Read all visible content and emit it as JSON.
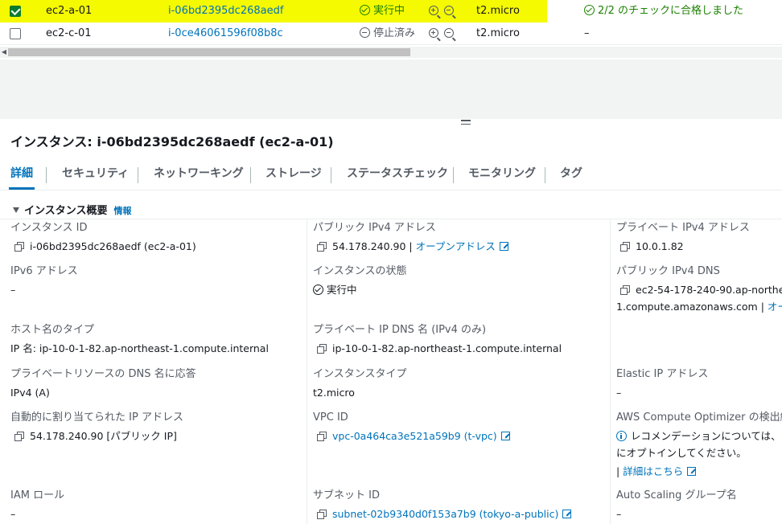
{
  "instances": {
    "rows": [
      {
        "selected": true,
        "name": "ec2-a-01",
        "instance_id": "i-06bd2395dc268aedf",
        "state": "実行中",
        "type": "t2.micro",
        "status_check": "2/2 のチェックに合格しました"
      },
      {
        "selected": false,
        "name": "ec2-c-01",
        "instance_id": "i-0ce46061596f08b8c",
        "state": "停止済み",
        "type": "t2.micro",
        "status_check": "–"
      }
    ],
    "highlight_color": "#f5fa00"
  },
  "detail": {
    "title": "インスタンス: i-06bd2395dc268aedf (ec2-a-01)",
    "tabs": [
      "詳細",
      "セキュリティ",
      "ネットワーキング",
      "ストレージ",
      "ステータスチェック",
      "モニタリング",
      "タグ"
    ],
    "active_tab": "詳細",
    "section_title": "インスタンス概要",
    "section_info": "情報",
    "col1": {
      "instance_id_label": "インスタンス ID",
      "instance_id_value": "i-06bd2395dc268aedf (ec2-a-01)",
      "ipv6_label": "IPv6 アドレス",
      "ipv6_value": "–",
      "hostname_type_label": "ホスト名のタイプ",
      "hostname_type_value": "IP 名: ip-10-0-1-82.ap-northeast-1.compute.internal",
      "private_dns_answer_label": "プライベートリソースの DNS 名に応答",
      "private_dns_answer_value": "IPv4 (A)",
      "auto_ip_label": "自動的に割り当てられた IP アドレス",
      "auto_ip_value": "54.178.240.90 [パブリック IP]",
      "iam_role_label": "IAM ロール",
      "iam_role_value": "–"
    },
    "col2": {
      "public_ipv4_label": "パブリック IPv4 アドレス",
      "public_ipv4_value": "54.178.240.90 |",
      "open_address": "オープンアドレス",
      "state_label": "インスタンスの状態",
      "state_value": "実行中",
      "private_ip_dns_label": "プライベート IP DNS 名 (IPv4 のみ)",
      "private_ip_dns_value": "ip-10-0-1-82.ap-northeast-1.compute.internal",
      "instance_type_label": "インスタンスタイプ",
      "instance_type_value": "t2.micro",
      "vpc_label": "VPC ID",
      "vpc_value": "vpc-0a464ca3e521a59b9 (t-vpc)",
      "subnet_label": "サブネット ID",
      "subnet_value": "subnet-02b9340d0f153a7b9 (tokyo-a-public)"
    },
    "col3": {
      "private_ipv4_label": "プライベート IPv4 アドレス",
      "private_ipv4_value": "10.0.1.82",
      "public_dns_label": "パブリック IPv4 DNS",
      "public_dns_value_1": "ec2-54-178-240-90.ap-northea",
      "public_dns_value_2": "1.compute.amazonaws.com |",
      "public_dns_open": "オープ",
      "elastic_ip_label": "Elastic IP アドレス",
      "elastic_ip_value": "–",
      "optimizer_label": "AWS Compute Optimizer の検出結果",
      "optimizer_value_1": "レコメンデーションについては、",
      "optimizer_value_2": "にオプトインしてください。",
      "optimizer_details_prefix": "|",
      "optimizer_details": "詳細はこちら",
      "asg_label": "Auto Scaling グループ名",
      "asg_value": "–"
    }
  },
  "colors": {
    "link": "#0073bb",
    "success": "#1d8102",
    "text": "#16191f",
    "muted": "#545b64"
  }
}
